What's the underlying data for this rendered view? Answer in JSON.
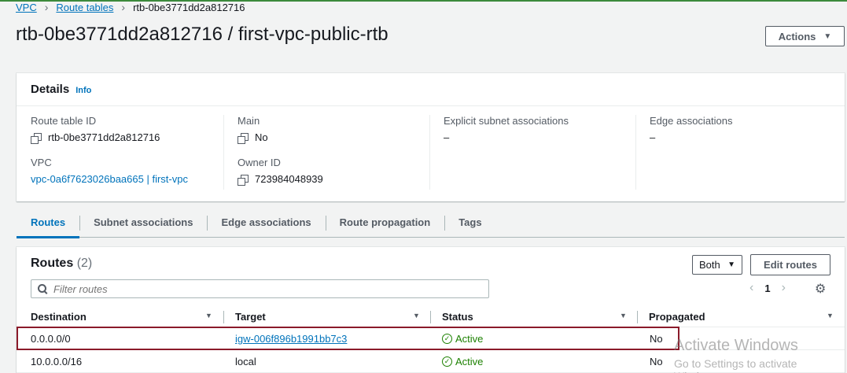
{
  "breadcrumb": {
    "vpc": "VPC",
    "route_tables": "Route tables",
    "current": "rtb-0be3771dd2a812716"
  },
  "title": "rtb-0be3771dd2a812716 / first-vpc-public-rtb",
  "actions_label": "Actions",
  "details": {
    "heading": "Details",
    "info": "Info",
    "route_table_id_label": "Route table ID",
    "route_table_id": "rtb-0be3771dd2a812716",
    "main_label": "Main",
    "main": "No",
    "explicit_label": "Explicit subnet associations",
    "explicit": "–",
    "edge_label": "Edge associations",
    "edge": "–",
    "vpc_label": "VPC",
    "vpc": "vpc-0a6f7623026baa665 | first-vpc",
    "owner_label": "Owner ID",
    "owner": "723984048939"
  },
  "tabs": [
    "Routes",
    "Subnet associations",
    "Edge associations",
    "Route propagation",
    "Tags"
  ],
  "routes": {
    "title": "Routes",
    "count": "(2)",
    "filter_select": "Both",
    "edit_label": "Edit routes",
    "filter_placeholder": "Filter routes",
    "page": "1",
    "columns": [
      "Destination",
      "Target",
      "Status",
      "Propagated"
    ],
    "rows": [
      {
        "destination": "0.0.0.0/0",
        "target": "igw-006f896b1991bb7c3",
        "status": "Active",
        "propagated": "No"
      },
      {
        "destination": "10.0.0.0/16",
        "target": "local",
        "status": "Active",
        "propagated": "No"
      }
    ]
  },
  "watermark": {
    "line1": "Activate Windows",
    "line2": "Go to Settings to activate Windows."
  },
  "colors": {
    "link": "#0073bb",
    "active_status": "#1d8102",
    "highlight": "#8b1a2a"
  }
}
